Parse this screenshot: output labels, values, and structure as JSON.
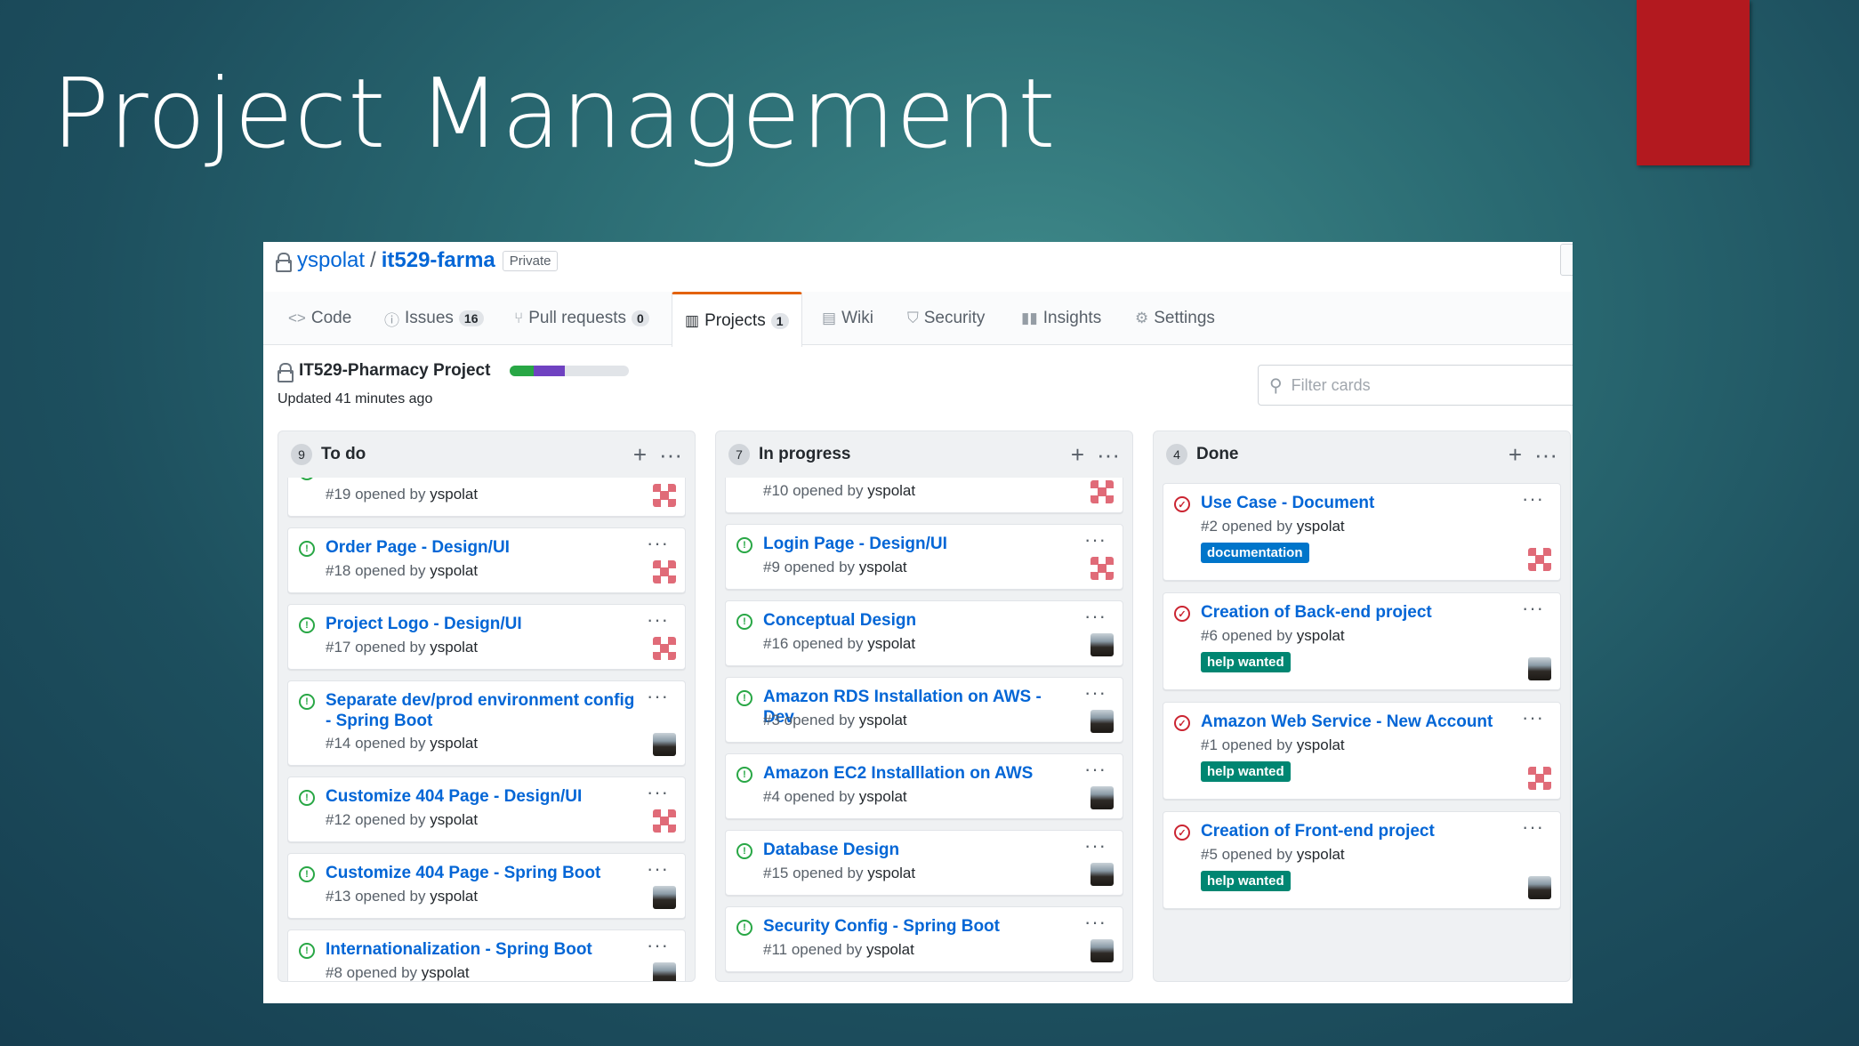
{
  "slide": {
    "title": "Project Management"
  },
  "repo": {
    "owner": "yspolat",
    "sep": "/",
    "name": "it529-farma",
    "visibility": "Private"
  },
  "tabs": [
    {
      "label": "Code",
      "icon": "code-icon"
    },
    {
      "label": "Issues",
      "icon": "issue-icon",
      "count": "16"
    },
    {
      "label": "Pull requests",
      "icon": "pull-request-icon",
      "count": "0"
    },
    {
      "label": "Projects",
      "icon": "project-icon",
      "count": "1",
      "active": true
    },
    {
      "label": "Wiki",
      "icon": "book-icon"
    },
    {
      "label": "Security",
      "icon": "shield-icon"
    },
    {
      "label": "Insights",
      "icon": "graph-icon"
    },
    {
      "label": "Settings",
      "icon": "gear-icon"
    }
  ],
  "project": {
    "title": "IT529-Pharmacy Project",
    "updated": "Updated 41 minutes ago",
    "progress": {
      "done": 0.2,
      "in_progress": 0.26
    },
    "filter_placeholder": "Filter cards"
  },
  "columns": [
    {
      "name": "To do",
      "count": "9",
      "cards": [
        {
          "title": "",
          "meta_prefix": "#19 opened by",
          "user": "yspolat",
          "avatar": "identicon",
          "cut": true
        },
        {
          "title": "Order Page - Design/UI",
          "meta_prefix": "#18 opened by",
          "user": "yspolat",
          "avatar": "identicon"
        },
        {
          "title": "Project Logo - Design/UI",
          "meta_prefix": "#17 opened by",
          "user": "yspolat",
          "avatar": "identicon"
        },
        {
          "title": "Separate dev/prod environment config - Spring Boot",
          "meta_prefix": "#14 opened by",
          "user": "yspolat",
          "avatar": "photo",
          "two_line": true
        },
        {
          "title": "Customize 404 Page - Design/UI",
          "meta_prefix": "#12 opened by",
          "user": "yspolat",
          "avatar": "identicon"
        },
        {
          "title": "Customize 404 Page - Spring Boot",
          "meta_prefix": "#13 opened by",
          "user": "yspolat",
          "avatar": "photo"
        },
        {
          "title": "Internationalization - Spring Boot",
          "meta_prefix": "#8 opened by",
          "user": "yspolat",
          "avatar": "photo"
        }
      ]
    },
    {
      "name": "In progress",
      "count": "7",
      "cards": [
        {
          "title": "",
          "meta_prefix": "#10 opened by",
          "user": "yspolat",
          "avatar": "identicon",
          "cut": true
        },
        {
          "title": "Login Page - Design/UI",
          "meta_prefix": "#9 opened by",
          "user": "yspolat",
          "avatar": "identicon"
        },
        {
          "title": "Conceptual Design",
          "meta_prefix": "#16 opened by",
          "user": "yspolat",
          "avatar": "photo"
        },
        {
          "title": "Amazon RDS Installation on AWS - Dev",
          "meta_prefix": "#3 opened by",
          "user": "yspolat",
          "avatar": "photo"
        },
        {
          "title": "Amazon EC2 Installlation on AWS",
          "meta_prefix": "#4 opened by",
          "user": "yspolat",
          "avatar": "photo"
        },
        {
          "title": "Database Design",
          "meta_prefix": "#15 opened by",
          "user": "yspolat",
          "avatar": "photo"
        },
        {
          "title": "Security Config - Spring Boot",
          "meta_prefix": "#11 opened by",
          "user": "yspolat",
          "avatar": "photo"
        }
      ]
    },
    {
      "name": "Done",
      "count": "4",
      "cards": [
        {
          "title": "Use Case - Document",
          "meta_prefix": "#2 opened by",
          "user": "yspolat",
          "avatar": "identicon",
          "label": "documentation",
          "label_color": "#0075ca",
          "closed": true
        },
        {
          "title": "Creation of Back-end project",
          "meta_prefix": "#6 opened by",
          "user": "yspolat",
          "avatar": "photo",
          "label": "help wanted",
          "label_color": "#008672",
          "closed": true
        },
        {
          "title": "Amazon Web Service - New Account",
          "meta_prefix": "#1 opened by",
          "user": "yspolat",
          "avatar": "identicon",
          "label": "help wanted",
          "label_color": "#008672",
          "closed": true
        },
        {
          "title": "Creation of Front-end project",
          "meta_prefix": "#5 opened by",
          "user": "yspolat",
          "avatar": "photo",
          "label": "help wanted",
          "label_color": "#008672",
          "closed": true
        }
      ]
    }
  ],
  "ui": {
    "add": "+",
    "menu": "···"
  },
  "colors": {
    "accent": "#0366d6",
    "open": "#28a745",
    "closed": "#cb2431",
    "slide_red": "#b3191f"
  }
}
